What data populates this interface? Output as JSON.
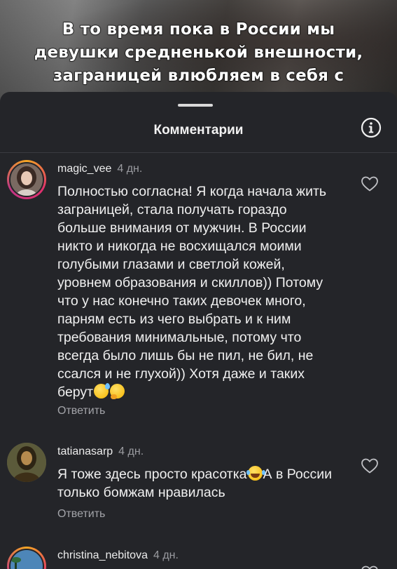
{
  "video": {
    "caption_lines": [
      "В то время пока в России мы",
      "девушки средненькой внешности,",
      "заграницей влюбляем в себя с"
    ]
  },
  "sheet": {
    "title": "Комментарии",
    "info_icon": "info-icon"
  },
  "comments": [
    {
      "username": "magic_vee",
      "time": "4 дн.",
      "text": "Полностью согласна! Я когда начала жить заграницей, стала получать гораздо больше внимания от мужчин. В России никто и никогда не восхищался моими голубыми глазами и светлой кожей, уровнем образования и скиллов)) Потому что у нас конечно таких девочек много, парням есть из чего выбрать и к ним требования минимальные, потому что всегда было лишь бы не пил, не бил, не ссался и не глухой)) Хотя даже и таких берут",
      "emojis": [
        "sweat-smile-emoji",
        "hugging-face-emoji"
      ],
      "reply_label": "Ответить",
      "like_icon": "heart-outline-icon"
    },
    {
      "username": "tatianasarp",
      "time": "4 дн.",
      "text_before": "Я тоже здесь просто красотка",
      "emoji": "tears-of-joy-emoji",
      "text_after": "А в России только бомжам нравилась",
      "reply_label": "Ответить",
      "like_icon": "heart-outline-icon"
    },
    {
      "username": "christina_nebitova",
      "time": "4 дн.",
      "like_icon": "heart-outline-icon"
    }
  ],
  "colors": {
    "sheet_bg": "#242529",
    "text": "#f0f0f0",
    "muted": "#9a9ba0",
    "story_ring": "#e1306c"
  }
}
